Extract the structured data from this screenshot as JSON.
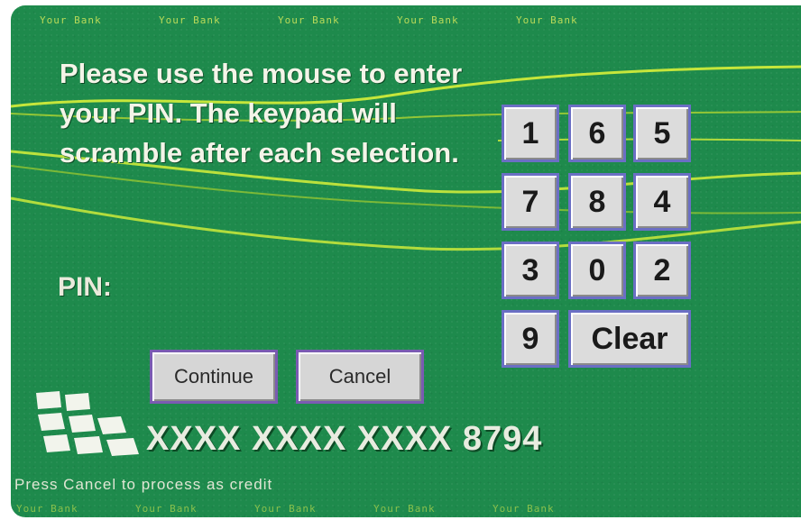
{
  "brand": {
    "top_text": [
      "Your Bank",
      "Your Bank",
      "Your Bank",
      "Your Bank",
      "Your Bank"
    ],
    "bottom_text": [
      "Your Bank",
      "Your Bank",
      "Your Bank",
      "Your Bank",
      "Your Bank"
    ]
  },
  "instructions": "Please use the mouse to enter your PIN. The keypad will scramble after each selection.",
  "pin_label": "PIN:",
  "keypad": {
    "rows": [
      [
        "1",
        "6",
        "5"
      ],
      [
        "7",
        "8",
        "4"
      ],
      [
        "3",
        "0",
        "2"
      ],
      [
        "9",
        "Clear"
      ]
    ]
  },
  "buttons": {
    "continue": "Continue",
    "cancel": "Cancel"
  },
  "card_number": "XXXX XXXX XXXX 8794",
  "footer_note": "Press Cancel to process as credit",
  "colors": {
    "card_background": "#1e8a4c",
    "wave_lines": "#d7f03a",
    "key_border": "#6b6fc4",
    "button_border": "#7a5bb2"
  }
}
